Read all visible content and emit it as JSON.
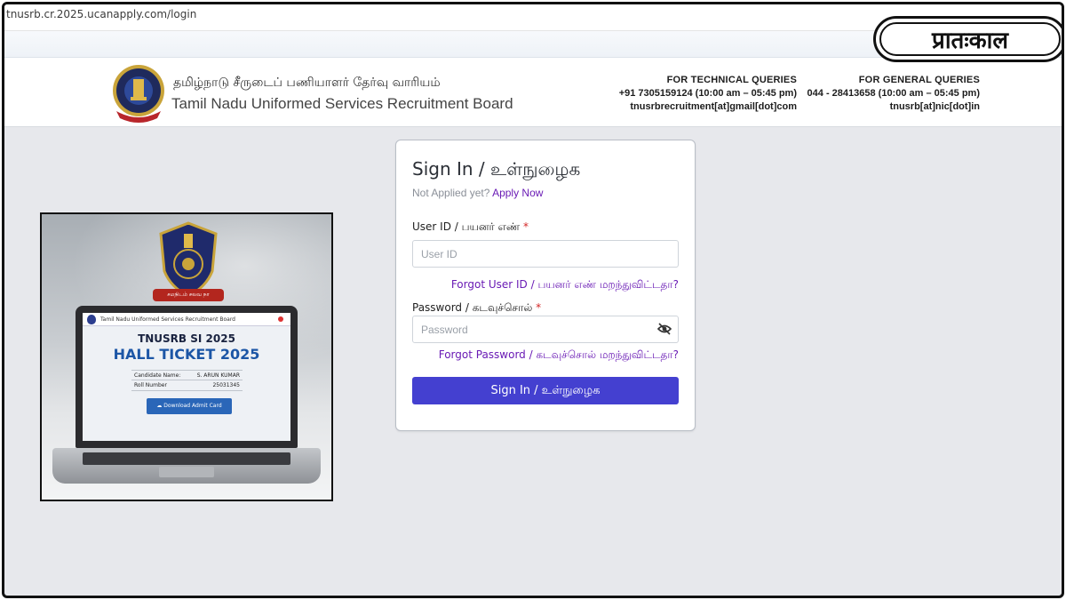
{
  "browser": {
    "url": "tnusrb.cr.2025.ucanapply.com/login"
  },
  "brand_logo": {
    "text": "प्रातःकाल"
  },
  "header": {
    "title_tamil": "தமிழ்நாடு சீருடைப் பணியாளர் தேர்வு வாரியம்",
    "title_english": "Tamil Nadu Uniformed Services Recruitment Board",
    "technical": {
      "heading": "FOR TECHNICAL QUERIES",
      "phone": "+91 7305159124  (10:00 am – 05:45 pm)",
      "email": "tnusrbrecruitment[at]gmail[dot]com"
    },
    "general": {
      "heading": "FOR GENERAL QUERIES",
      "phone": "044 - 28413658  (10:00 am – 05:45 pm)",
      "email": "tnusrb[at]nic[dot]in"
    }
  },
  "promo": {
    "ribbon": "சமநிடம் சலவ நா",
    "screen_header": "Tamil Nadu Uniformed Services Recruitment Board",
    "line1": "TNUSRB SI 2025",
    "line2": "HALL TICKET 2025",
    "candidate_label": "Candidate Name:",
    "candidate_value": "S. ARUN KUMAR",
    "roll_label": "Roll Number",
    "roll_value": "25031345",
    "download_button": "Download Admit Card"
  },
  "login": {
    "heading": "Sign In / உள்நுழைக",
    "not_applied": "Not Applied yet?",
    "apply_now": "Apply Now",
    "user_label": "User ID / பயனர் எண்",
    "required_mark": "*",
    "user_placeholder": "User ID",
    "forgot_user": "Forgot User ID / பயனர் எண் மறந்துவிட்டதா?",
    "password_label": "Password / கடவுச்சொல்",
    "password_placeholder": "Password",
    "forgot_password": "Forgot Password / கடவுச்சொல் மறந்துவிட்டதா?",
    "submit": "Sign In / உள்நுழைக"
  },
  "colors": {
    "primary_button": "#4440d0",
    "link": "#6a1bb5",
    "required": "#d32626",
    "page_bg": "#e7e8ec"
  }
}
